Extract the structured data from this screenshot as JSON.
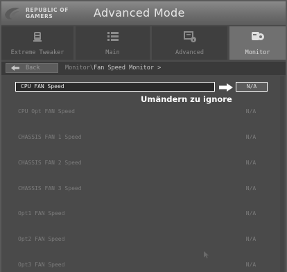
{
  "header": {
    "brand_line1": "REPUBLIC OF",
    "brand_line2": "GAMERS",
    "title": "Advanced Mode"
  },
  "tabs": [
    {
      "label": "Extreme Tweaker",
      "icon": "extreme-tweaker-icon",
      "active": false
    },
    {
      "label": "Main",
      "icon": "list-icon",
      "active": false
    },
    {
      "label": "Advanced",
      "icon": "advanced-settings-icon",
      "active": false
    },
    {
      "label": "Monitor",
      "icon": "monitor-gear-icon",
      "active": true
    }
  ],
  "nav": {
    "back_label": "Back",
    "breadcrumb_root": "Monitor\\",
    "breadcrumb_current": "Fan Speed Monitor >"
  },
  "rows": [
    {
      "label": "CPU FAN Speed",
      "value": "N/A"
    },
    {
      "label": "CPU Opt FAN Speed",
      "value": "N/A"
    },
    {
      "label": "CHASSIS FAN 1 Speed",
      "value": "N/A"
    },
    {
      "label": "CHASSIS FAN 2 Speed",
      "value": "N/A"
    },
    {
      "label": "CHASSIS FAN 3 Speed",
      "value": "N/A"
    },
    {
      "label": "Opt1 FAN Speed",
      "value": "N/A"
    },
    {
      "label": "Opt2 FAN Speed",
      "value": "N/A"
    },
    {
      "label": "Opt3 FAN Speed",
      "value": "N/A"
    }
  ],
  "annotation": "Umändern zu ignore",
  "colors": {
    "accent_highlight": "#ffffff",
    "active_tab": "#707070",
    "background": "#4a4a4a"
  }
}
